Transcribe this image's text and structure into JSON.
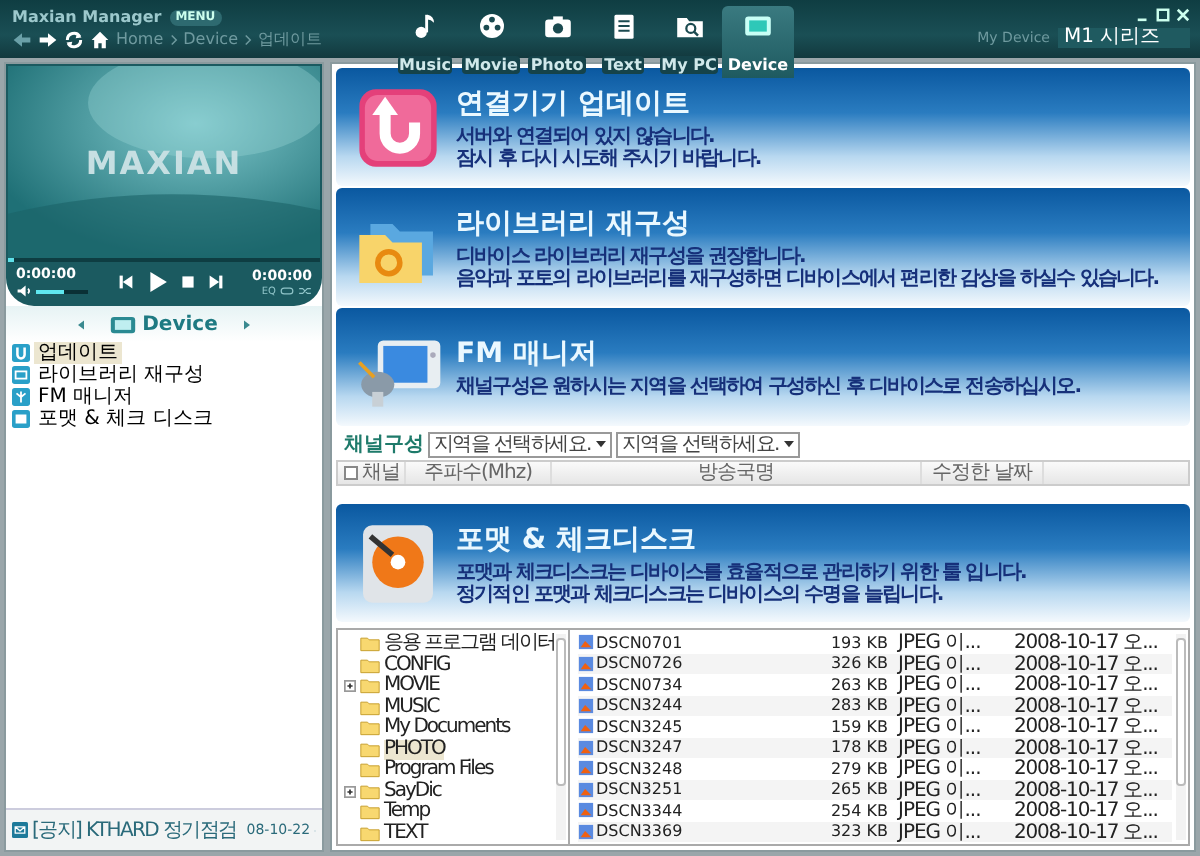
{
  "window": {
    "title": "Maxian Manager",
    "menu_badge": "MENU"
  },
  "nav_tabs": [
    {
      "label": "Music",
      "kind": "music",
      "selected": false
    },
    {
      "label": "Movie",
      "kind": "movie",
      "selected": false
    },
    {
      "label": "Photo",
      "selected": false
    },
    {
      "label": "Text",
      "kind": "text",
      "selected": false
    },
    {
      "label": "My PC",
      "kind": "mypc",
      "selected": false
    },
    {
      "label": "Device",
      "kind": "device",
      "selected": true
    }
  ],
  "breadcrumb": [
    "Home",
    "Device",
    "업데이트"
  ],
  "device_picker": {
    "label": "My Device",
    "value": "M1 시리즈"
  },
  "player": {
    "logo": "MAXIAN",
    "elapsed": "0:00:00",
    "total": "0:00:00",
    "volume": {
      "level": 0.55
    },
    "progress": {
      "level": 0.0
    },
    "modes": [
      "EQ"
    ]
  },
  "sidebar": {
    "title": "Device",
    "items": [
      {
        "label": "업데이트",
        "kind": "update",
        "selected": true
      },
      {
        "label": "라이브러리 재구성",
        "kind": "library",
        "selected": false
      },
      {
        "label": "FM 매니저",
        "kind": "fm",
        "selected": false
      },
      {
        "label": "포맷 & 체크 디스크",
        "kind": "format",
        "selected": false
      }
    ],
    "notice": {
      "text": "[공지] KTHARD 정기점검",
      "date": "08-10-22"
    }
  },
  "sections": [
    {
      "kind": "update",
      "title": "연결기기 업데이트",
      "lines": [
        "서버와 연결되어 있지 않습니다.",
        "잠시 후 다시 시도해 주시기 바랍니다."
      ]
    },
    {
      "kind": "library",
      "title": "라이브러리 재구성",
      "lines": [
        "디바이스 라이브러리 재구성을 권장합니다.",
        "음악과 포토의 라이브러리를 재구성하면 디바이스에서 편리한 감상을 하실수 있습니다."
      ]
    },
    {
      "kind": "fm",
      "title": "FM 매니저",
      "lines": [
        "채널구성은 원하시는 지역을 선택하여 구성하신 후 디바이스로 전송하십시오."
      ]
    }
  ],
  "channel_config": {
    "label": "채널구성",
    "selects": [
      {
        "placeholder": "지역을 선택하세요."
      },
      {
        "placeholder": "지역을 선택하세요."
      }
    ],
    "table": {
      "select_all_checked": false,
      "columns": [
        "채널",
        "주파수(Mhz)",
        "방송국명",
        "수정한 날짜"
      ]
    }
  },
  "format_section": {
    "kind": "format",
    "title": "포맷 & 체크디스크",
    "lines": [
      "포맷과 체크디스크는 디바이스를 효율적으로 관리하기 위한 툴 입니다.",
      "정기적인 포맷과 체크디스크는 디바이스의 수명을 늘립니다."
    ]
  },
  "folder_tree": [
    {
      "label": "응용 프로그램 데이터",
      "expandable": false,
      "selected": false
    },
    {
      "label": "CONFIG",
      "expandable": false,
      "selected": false
    },
    {
      "label": "MOVIE",
      "expandable": true,
      "selected": false
    },
    {
      "label": "MUSIC",
      "expandable": false,
      "selected": false
    },
    {
      "label": "My Documents",
      "expandable": false,
      "selected": false
    },
    {
      "label": "PHOTO",
      "expandable": false,
      "selected": true
    },
    {
      "label": "Program Files",
      "expandable": false,
      "selected": false
    },
    {
      "label": "SayDic",
      "expandable": true,
      "selected": false
    },
    {
      "label": "Temp",
      "expandable": false,
      "selected": false
    },
    {
      "label": "TEXT",
      "expandable": false,
      "selected": false
    }
  ],
  "files": [
    {
      "name": "DSCN0701",
      "size": "193 KB",
      "type": "JPEG 이...",
      "date": "2008-10-17 오..."
    },
    {
      "name": "DSCN0726",
      "size": "326 KB",
      "type": "JPEG 이...",
      "date": "2008-10-17 오..."
    },
    {
      "name": "DSCN0734",
      "size": "263 KB",
      "type": "JPEG 이...",
      "date": "2008-10-17 오..."
    },
    {
      "name": "DSCN3244",
      "size": "283 KB",
      "type": "JPEG 이...",
      "date": "2008-10-17 오..."
    },
    {
      "name": "DSCN3245",
      "size": "159 KB",
      "type": "JPEG 이...",
      "date": "2008-10-17 오..."
    },
    {
      "name": "DSCN3247",
      "size": "178 KB",
      "type": "JPEG 이...",
      "date": "2008-10-17 오..."
    },
    {
      "name": "DSCN3248",
      "size": "279 KB",
      "type": "JPEG 이...",
      "date": "2008-10-17 오..."
    },
    {
      "name": "DSCN3251",
      "size": "265 KB",
      "type": "JPEG 이...",
      "date": "2008-10-17 오..."
    },
    {
      "name": "DSCN3344",
      "size": "254 KB",
      "type": "JPEG 이...",
      "date": "2008-10-17 오..."
    },
    {
      "name": "DSCN3369",
      "size": "323 KB",
      "type": "JPEG 이...",
      "date": "2008-10-17 오..."
    }
  ]
}
